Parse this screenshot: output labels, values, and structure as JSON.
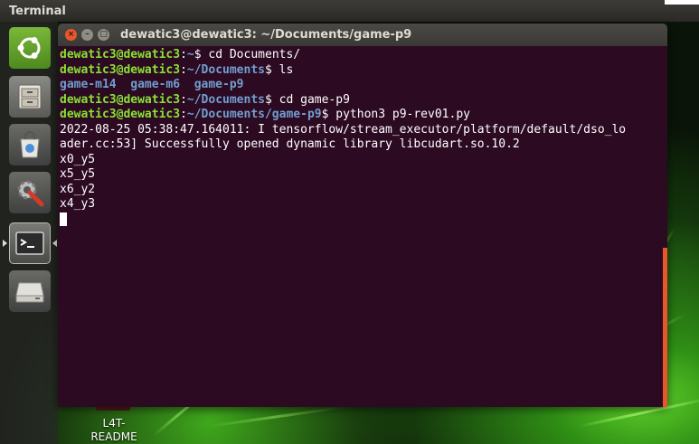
{
  "top_panel": {
    "title": "Terminal"
  },
  "launcher": {
    "items": [
      {
        "name": "dash",
        "icon": "ubuntu-logo-icon"
      },
      {
        "name": "files",
        "icon": "file-cabinet-icon"
      },
      {
        "name": "software-center",
        "icon": "shopping-bag-icon"
      },
      {
        "name": "system-settings",
        "icon": "wrench-gear-icon"
      },
      {
        "name": "terminal",
        "icon": "terminal-icon"
      },
      {
        "name": "drive",
        "icon": "drive-icon"
      }
    ]
  },
  "desktop": {
    "folder_label_line1": "L4T-",
    "folder_label_line2": "README"
  },
  "window": {
    "title": "dewatic3@dewatic3: ~/Documents/game-p9",
    "close_glyph": "×",
    "min_glyph": "–",
    "max_glyph": "□"
  },
  "terminal": {
    "user": "dewatic3@dewatic3",
    "lines": [
      {
        "path": "~",
        "cmd": "cd Documents/"
      },
      {
        "path": "~/Documents",
        "cmd": "ls"
      },
      {
        "output_dirs": "game-m14  game-m6  game-p9"
      },
      {
        "path": "~/Documents",
        "cmd": "cd game-p9"
      },
      {
        "path": "~/Documents/game-p9",
        "cmd": "python3 p9-rev01.py"
      },
      {
        "output": "2022-08-25 05:38:47.164011: I tensorflow/stream_executor/platform/default/dso_lo"
      },
      {
        "output": "ader.cc:53] Successfully opened dynamic library libcudart.so.10.2"
      },
      {
        "output": "x0_y5"
      },
      {
        "output": "x5_y5"
      },
      {
        "output": "x6_y2"
      },
      {
        "output": "x4_y3"
      }
    ]
  },
  "colors": {
    "terminal_bg": "#2c0a22",
    "prompt_user": "#8ae234",
    "prompt_path": "#729fcf",
    "close_button": "#e8572b",
    "scrollbar": "#e8572b"
  }
}
